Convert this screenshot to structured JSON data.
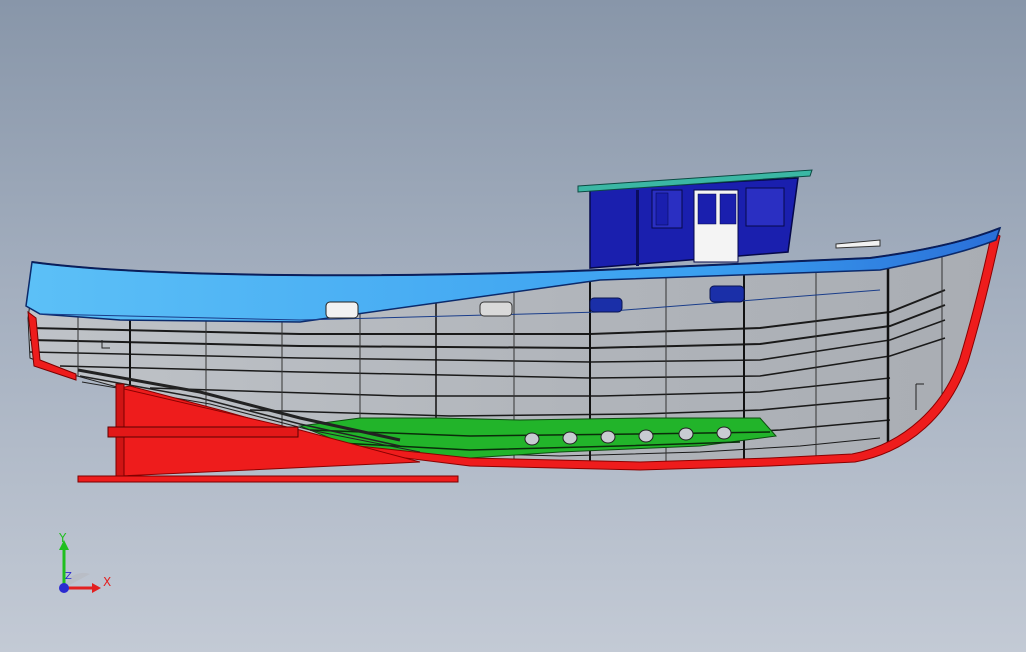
{
  "viewport": {
    "background_top": "#8896a9",
    "background_bottom": "#c3cad5"
  },
  "model": {
    "colors": {
      "bulwark": "#3fa9f2",
      "cabin": "#1a1fae",
      "hull_plating": "#b4b8be",
      "keel_stem": "#ee1c1c",
      "bilge_band": "#22b42a",
      "cabin_roof": "#3bb7a4",
      "frame_lines": "#111111"
    }
  },
  "triad": {
    "x_label": "X",
    "y_label": "Y",
    "z_label": "Z",
    "x_color": "#e32020",
    "y_color": "#1fbf1f",
    "z_color": "#2a2ad0"
  }
}
